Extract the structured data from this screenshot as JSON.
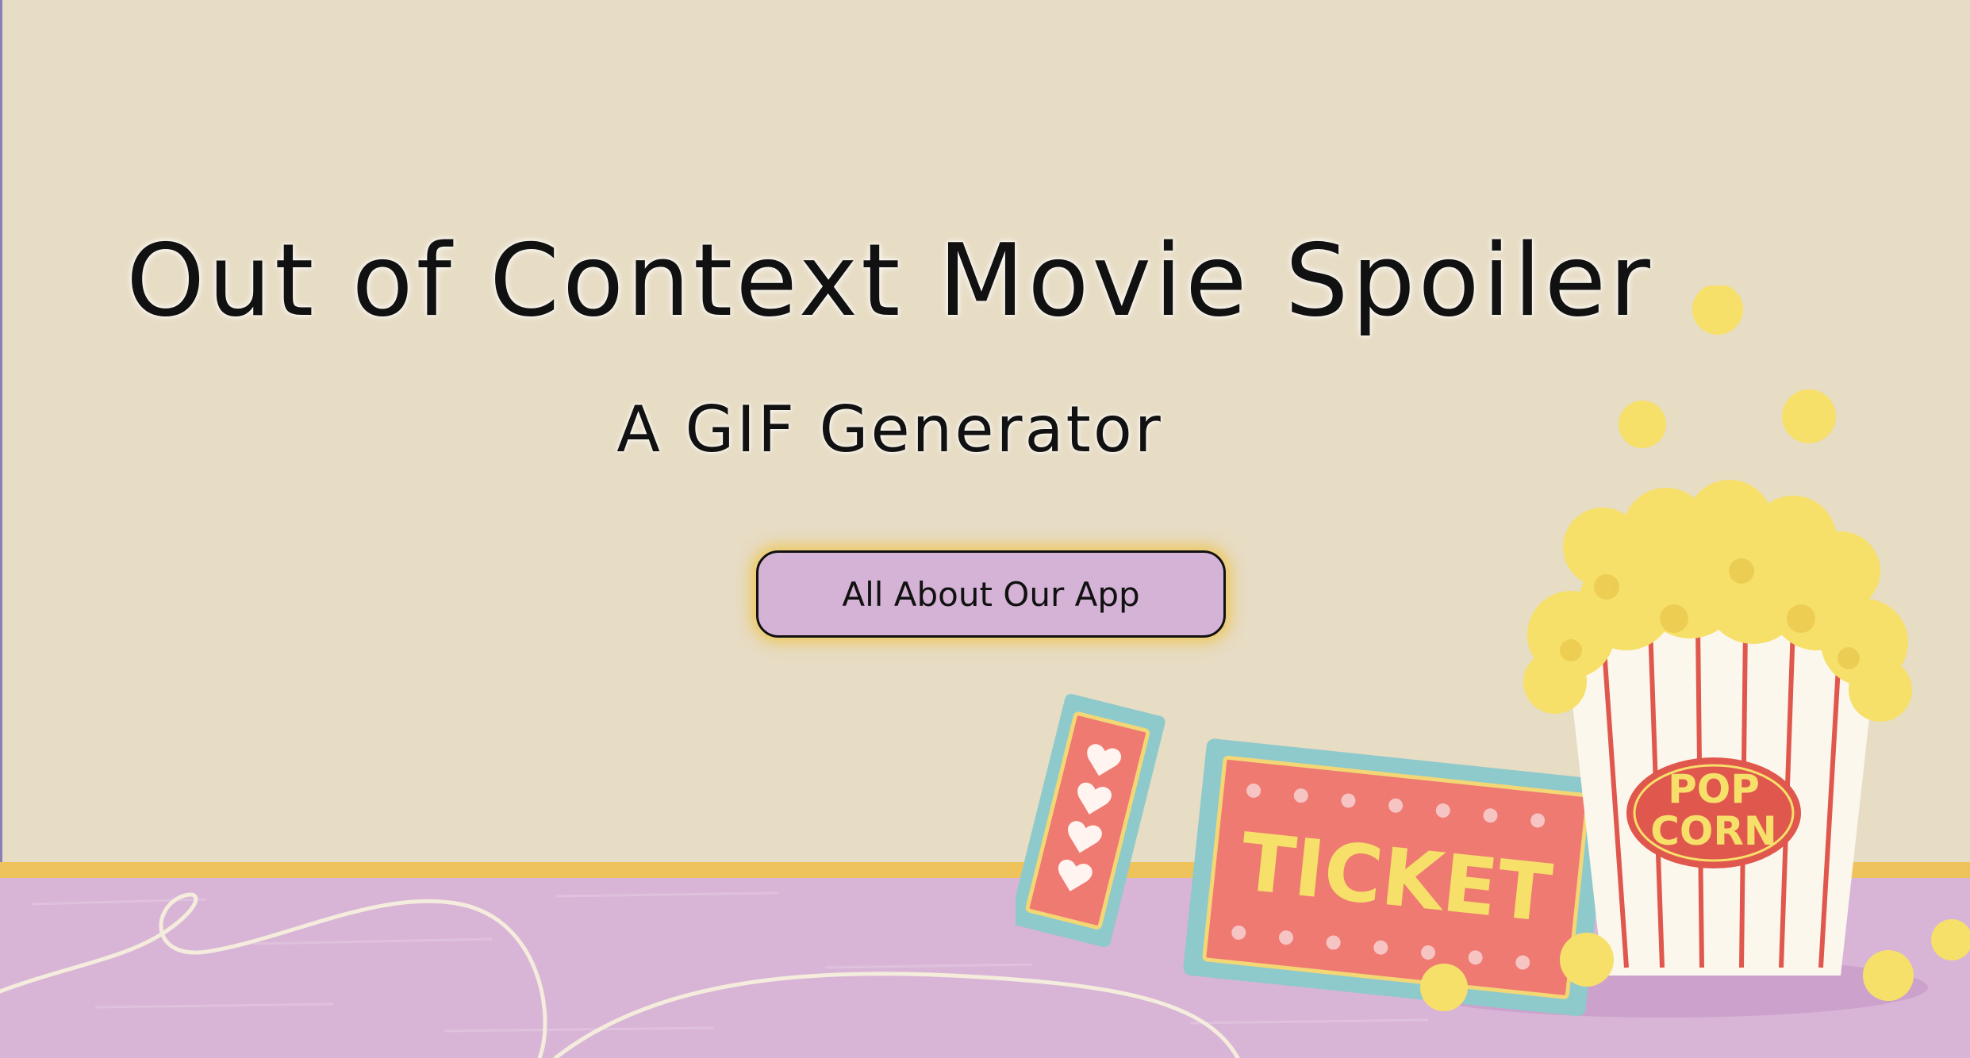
{
  "hero": {
    "title": "Out of Context Movie Spoiler",
    "subtitle": "A GIF Generator",
    "cta_label": "All About Our App"
  },
  "illustration": {
    "ticket_text": "TICKET",
    "popcorn_text_line1": "POP",
    "popcorn_text_line2": "CORN"
  },
  "colors": {
    "wall": "#e7dcc4",
    "floor": "#d8b5d6",
    "trim": "#eec35b",
    "button_fill": "#d5b3d6",
    "button_glow": "#eec346",
    "ticket_red": "#ee7a72",
    "ticket_teal": "#8ec9cc",
    "popcorn_yellow": "#f6e06a"
  }
}
